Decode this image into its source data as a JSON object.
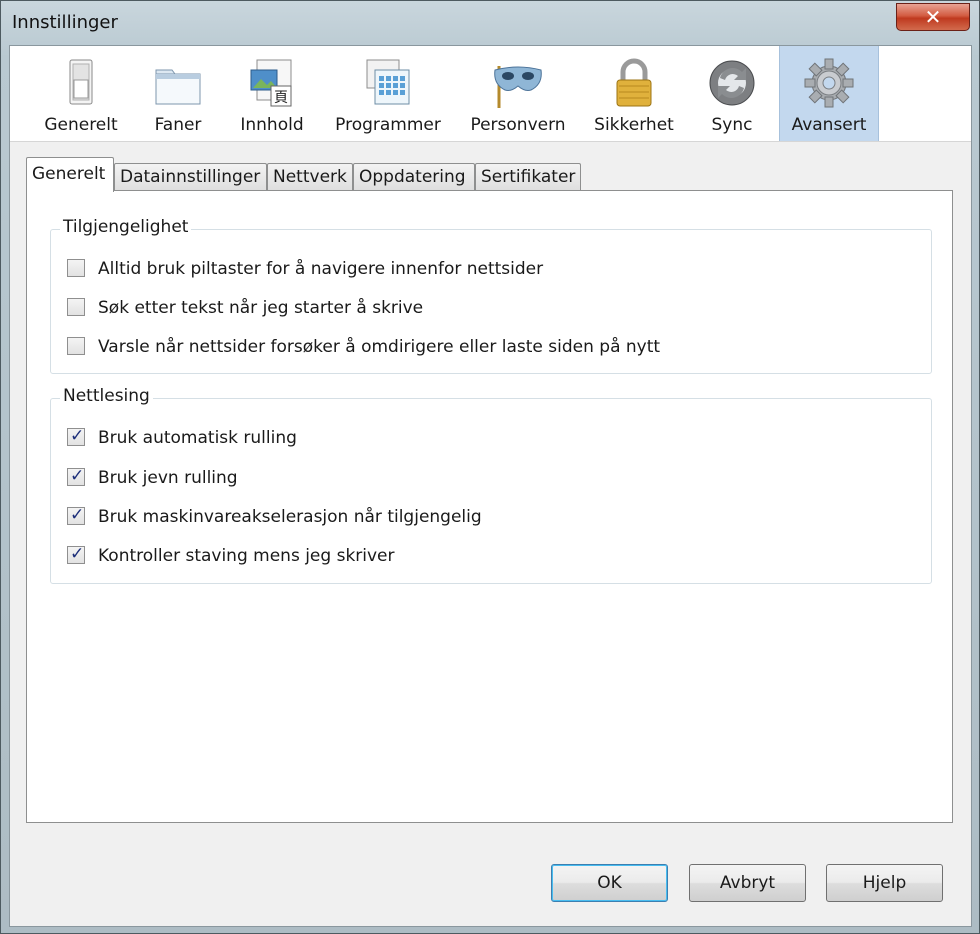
{
  "window": {
    "title": "Innstillinger",
    "close_symbol": "✕"
  },
  "toolbar": {
    "selected": "Avansert",
    "panes": [
      {
        "id": "generelt",
        "label": "Generelt",
        "icon": "switch-icon"
      },
      {
        "id": "faner",
        "label": "Faner",
        "icon": "tabs-icon"
      },
      {
        "id": "innhold",
        "label": "Innhold",
        "icon": "content-icon"
      },
      {
        "id": "programmer",
        "label": "Programmer",
        "icon": "applications-icon"
      },
      {
        "id": "personvern",
        "label": "Personvern",
        "icon": "mask-icon"
      },
      {
        "id": "sikkerhet",
        "label": "Sikkerhet",
        "icon": "padlock-icon"
      },
      {
        "id": "sync",
        "label": "Sync",
        "icon": "sync-icon"
      },
      {
        "id": "avansert",
        "label": "Avansert",
        "icon": "gear-icon"
      }
    ]
  },
  "tabs": {
    "active": "Generelt",
    "items": [
      "Generelt",
      "Datainnstillinger",
      "Nettverk",
      "Oppdatering",
      "Sertifikater"
    ]
  },
  "groups": {
    "accessibility": {
      "title": "Tilgjengelighet",
      "options": [
        {
          "label": "Alltid bruk piltaster for å navigere innenfor nettsider",
          "checked": false
        },
        {
          "label": "Søk etter tekst når jeg starter å skrive",
          "checked": false
        },
        {
          "label": "Varsle når nettsider forsøker å omdirigere eller laste siden på nytt",
          "checked": false
        }
      ]
    },
    "browsing": {
      "title": "Nettlesing",
      "options": [
        {
          "label": "Bruk automatisk rulling",
          "checked": true
        },
        {
          "label": "Bruk jevn rulling",
          "checked": true
        },
        {
          "label": "Bruk maskinvareakselerasjon når tilgjengelig",
          "checked": true
        },
        {
          "label": "Kontroller staving mens jeg skriver",
          "checked": true
        }
      ]
    }
  },
  "buttons": {
    "ok": "OK",
    "cancel": "Avbryt",
    "help": "Hjelp"
  },
  "colors": {
    "selected_pane": "#c3d8ee",
    "close_button": "#c9432a",
    "check_mark": "#1d2f7a"
  }
}
